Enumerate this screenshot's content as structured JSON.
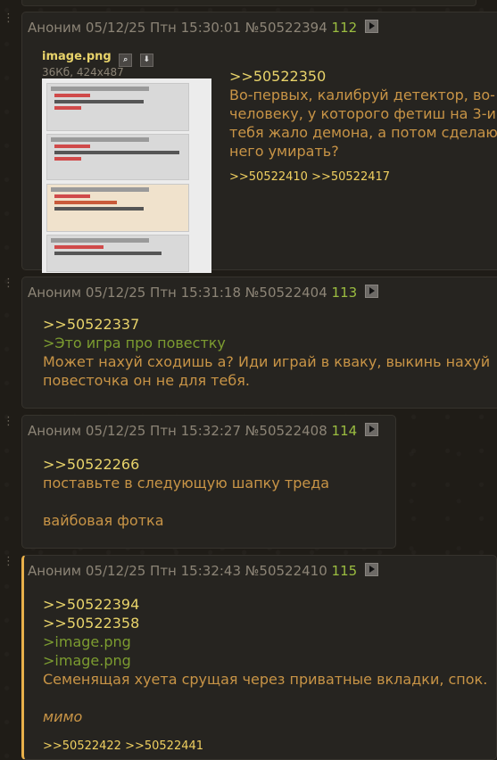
{
  "posts": [
    {
      "author": "Аноним",
      "date": "05/12/25 Птн 15:30:01",
      "num": "№50522394",
      "index": "112",
      "file": {
        "name": "image.png",
        "meta": "36Кб, 424x487"
      },
      "reply": ">>50522350",
      "lines": [
        "Во-первых, калибруй детектор, во-",
        "человеку, у которого фетиш на 3-и",
        "тебя жало демона, а потом сделают",
        "него умирать?"
      ],
      "refs": ">>50522410 >>50522417"
    },
    {
      "author": "Аноним",
      "date": "05/12/25 Птн 15:31:18",
      "num": "№50522404",
      "index": "113",
      "reply": ">>50522337",
      "quote": ">Это игра про повестку",
      "lines": [
        "Может нахуй сходишь а? Иди играй в кваку, выкинь нахуй",
        "повесточка он не для тебя."
      ]
    },
    {
      "author": "Аноним",
      "date": "05/12/25 Птн 15:32:27",
      "num": "№50522408",
      "index": "114",
      "reply": ">>50522266",
      "lines": [
        "поставьте в следующую шапку треда",
        "",
        "вайбовая фотка"
      ]
    },
    {
      "author": "Аноним",
      "date": "05/12/25 Птн 15:32:43",
      "num": "№50522410",
      "index": "115",
      "replies": [
        ">>50522394",
        ">>50522358"
      ],
      "quotes": [
        ">image.png",
        ">image.png"
      ],
      "line": "Семенящая хуета срущая через приватные вкладки, спок.",
      "italic": "мимо",
      "refs": ">>50522422 >>50522441"
    }
  ]
}
